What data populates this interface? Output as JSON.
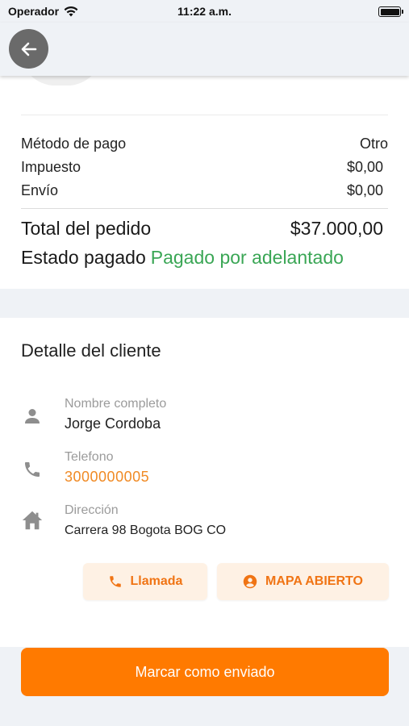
{
  "status_bar": {
    "carrier": "Operador",
    "time": "11:22 a.m."
  },
  "nav": {
    "back_icon": "arrow-left-icon"
  },
  "summary": {
    "payment_method_label": "Método de pago",
    "payment_method_value": "Otro",
    "tax_label": "Impuesto",
    "tax_value": "$0,00",
    "shipping_label": "Envío",
    "shipping_value": "$0,00",
    "total_label": "Total del pedido",
    "total_value": "$37.000,00",
    "paid_status_label": "Estado pagado",
    "paid_status_value": "Pagado por adelantado"
  },
  "customer": {
    "title": "Detalle del cliente",
    "name_label": "Nombre completo",
    "name_value": "Jorge Cordoba",
    "phone_label": "Telefono",
    "phone_value": "3000000005",
    "address_label": "Dirección",
    "address_value": "Carrera 98 Bogota BOG CO",
    "call_button": "Llamada",
    "map_button": "MAPA ABIERTO"
  },
  "footer": {
    "mark_shipped_button": "Marcar como enviado"
  },
  "colors": {
    "accent": "#ff7a00",
    "phone_text": "#f08a24",
    "paid_status": "#3aa655",
    "action_bg": "#fef1e4",
    "page_bg": "#eff2f6"
  }
}
